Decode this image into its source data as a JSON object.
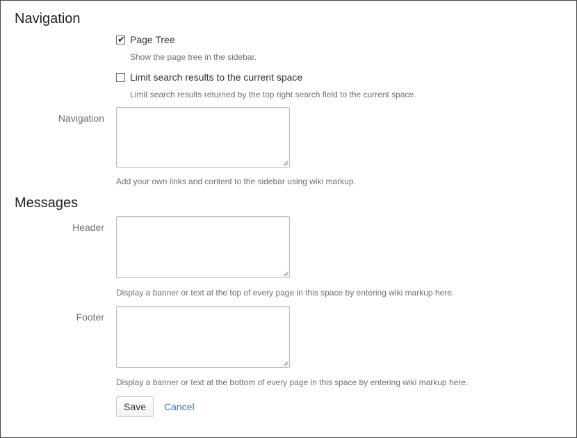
{
  "navigation": {
    "heading": "Navigation",
    "page_tree": {
      "label": "Page Tree",
      "checked": true,
      "description": "Show the page tree in the sidebar."
    },
    "limit_search": {
      "label": "Limit search results to the current space",
      "checked": false,
      "description": "Limit search results returned by the top right search field to the current space."
    },
    "navigation_field": {
      "label": "Navigation",
      "value": "",
      "description": "Add your own links and content to the sidebar using wiki markup."
    }
  },
  "messages": {
    "heading": "Messages",
    "header_field": {
      "label": "Header",
      "value": "",
      "description": "Display a banner or text at the top of every page in this space by entering wiki markup here."
    },
    "footer_field": {
      "label": "Footer",
      "value": "",
      "description": "Display a banner or text at the bottom of every page in this space by entering wiki markup here."
    }
  },
  "actions": {
    "save_label": "Save",
    "cancel_label": "Cancel"
  },
  "colors": {
    "link": "#3b73af",
    "description_text": "#707070",
    "border": "#bdbdbd"
  },
  "icons": {
    "checked": "check-mark-icon",
    "resize": "resize-grip-icon"
  }
}
